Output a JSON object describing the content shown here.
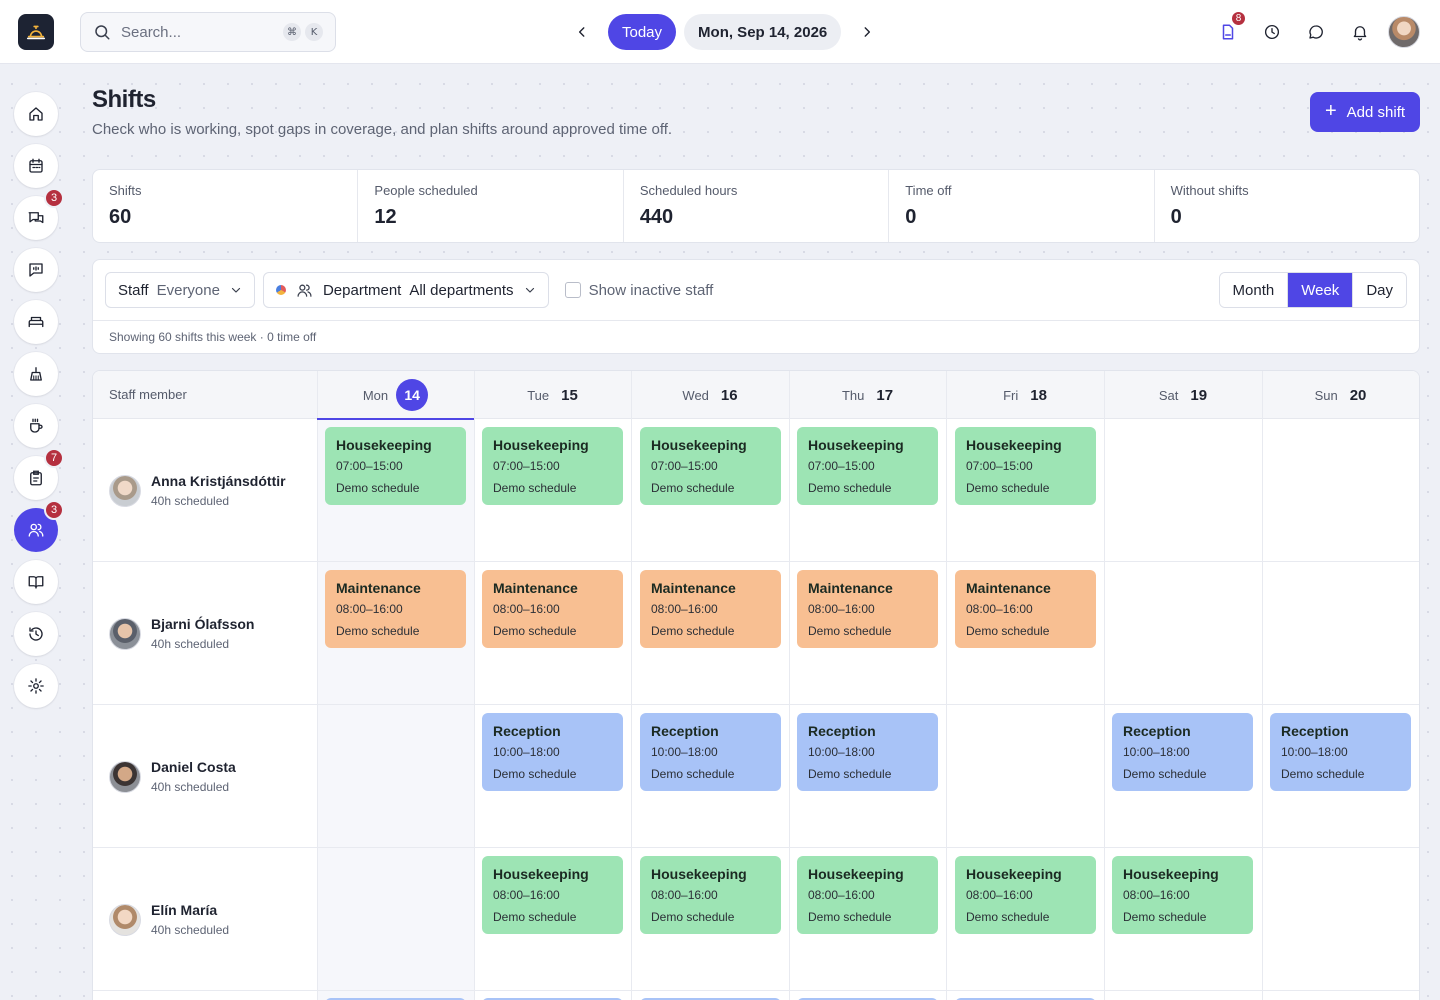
{
  "search": {
    "placeholder": "Search...",
    "kbd1": "⌘",
    "kbd2": "K"
  },
  "datenav": {
    "today": "Today",
    "date": "Mon, Sep 14, 2026"
  },
  "top_badges": {
    "tasks": "8"
  },
  "sidebar": {
    "items": [
      {
        "name": "home",
        "badge": ""
      },
      {
        "name": "calendar",
        "badge": ""
      },
      {
        "name": "conversations",
        "badge": "3"
      },
      {
        "name": "feedback",
        "badge": ""
      },
      {
        "name": "rooms",
        "badge": ""
      },
      {
        "name": "housekeeping",
        "badge": ""
      },
      {
        "name": "breakfast",
        "badge": ""
      },
      {
        "name": "tasks",
        "badge": "7"
      },
      {
        "name": "staff",
        "badge": "3"
      },
      {
        "name": "guidebook",
        "badge": ""
      },
      {
        "name": "history",
        "badge": ""
      },
      {
        "name": "settings",
        "badge": ""
      }
    ]
  },
  "header": {
    "title": "Shifts",
    "subtitle": "Check who is working, spot gaps in coverage, and plan shifts around approved time off.",
    "add_shift": "Add shift"
  },
  "stats": [
    {
      "label": "Shifts",
      "value": "60"
    },
    {
      "label": "People scheduled",
      "value": "12"
    },
    {
      "label": "Scheduled hours",
      "value": "440"
    },
    {
      "label": "Time off",
      "value": "0"
    },
    {
      "label": "Without shifts",
      "value": "0"
    }
  ],
  "filters": {
    "staff_label": "Staff",
    "staff_value": "Everyone",
    "dept_label": "Department",
    "dept_value": "All departments",
    "inactive_label": "Show inactive staff",
    "views": [
      "Month",
      "Week",
      "Day"
    ],
    "active_view": "Week",
    "showing": "Showing 60 shifts this week · 0 time off"
  },
  "grid": {
    "staff_header": "Staff member",
    "days": [
      {
        "name": "Mon",
        "num": "14"
      },
      {
        "name": "Tue",
        "num": "15"
      },
      {
        "name": "Wed",
        "num": "16"
      },
      {
        "name": "Thu",
        "num": "17"
      },
      {
        "name": "Fri",
        "num": "18"
      },
      {
        "name": "Sat",
        "num": "19"
      },
      {
        "name": "Sun",
        "num": "20"
      }
    ],
    "staff": [
      {
        "name": "Anna Kristjánsdóttir",
        "hours": "40h scheduled"
      },
      {
        "name": "Bjarni Ólafsson",
        "hours": "40h scheduled"
      },
      {
        "name": "Daniel Costa",
        "hours": "40h scheduled"
      },
      {
        "name": "Elín María",
        "hours": "40h scheduled"
      }
    ],
    "schedule_label": "Demo schedule",
    "shift_types": {
      "housekeeping": {
        "title": "Housekeeping",
        "color": "#9de4b4"
      },
      "maintenance": {
        "title": "Maintenance",
        "color": "#f8bf92"
      },
      "reception": {
        "title": "Reception",
        "color": "#a8c3f7"
      }
    },
    "times": {
      "a": "07:00–15:00",
      "b": "08:00–16:00",
      "c": "10:00–18:00"
    }
  },
  "colors": {
    "accent": "#4f46e5",
    "badge": "#b5303f"
  }
}
